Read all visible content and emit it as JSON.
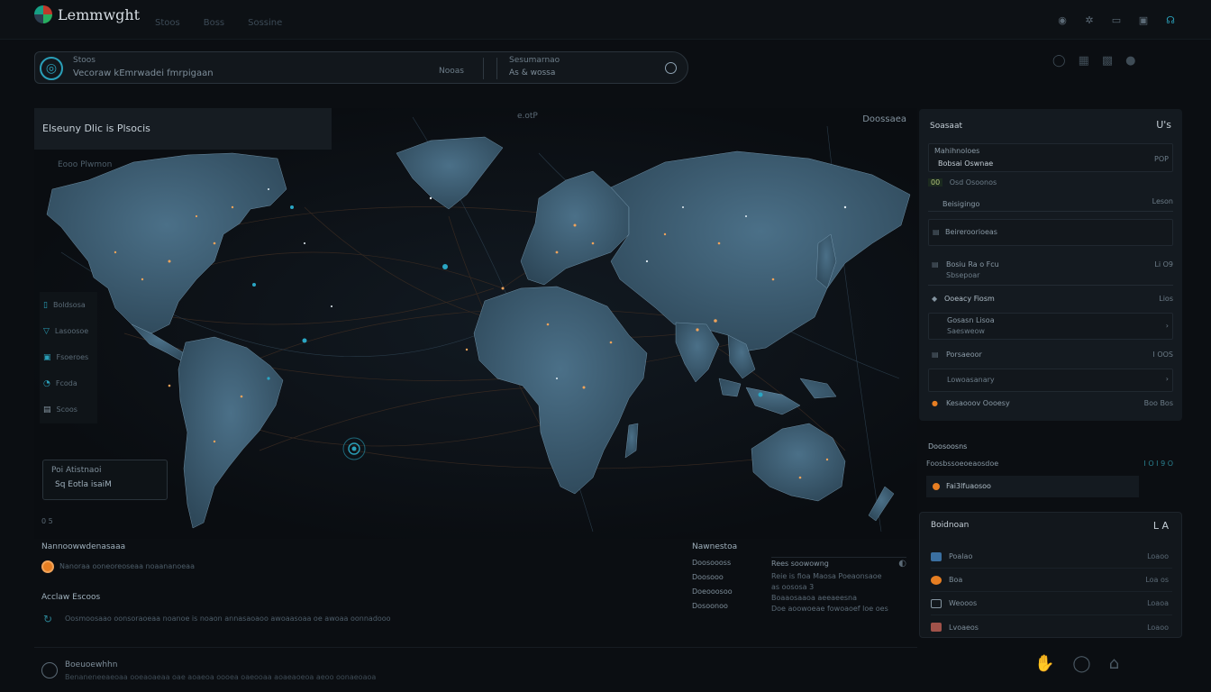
{
  "app": {
    "title": "Lemmwght",
    "nav": [
      "Stoos",
      "Boss",
      "Sossine"
    ]
  },
  "topbar_icons": [
    "location-icon",
    "settings-icon",
    "chat-icon",
    "monitor-icon",
    "user-icon"
  ],
  "search": {
    "title": "Stoos",
    "subtitle": "Vecoraw kEmrwadei fmrpigaan",
    "mid": "Nooas",
    "right_title": "Sesumarnao",
    "right_sub": "As & wossa"
  },
  "map_panel": {
    "title": "Elseuny  Dlic is Plsocis",
    "top_right_label": "Doossaea",
    "top_small": "e.otP",
    "sub_label": "Eooo Plwmon",
    "legend": [
      {
        "icon": "book-icon",
        "label": "Boldsosa"
      },
      {
        "icon": "shield-icon",
        "label": "Lasoosoe"
      },
      {
        "icon": "monitor-icon",
        "label": "Fsoeroes"
      },
      {
        "icon": "user-icon",
        "label": "Fcoda"
      },
      {
        "icon": "flag-icon",
        "label": "Scoos"
      }
    ],
    "location_title": "Poi Atistnaoi",
    "location_value": "Sq  Eotla isaiM",
    "footer": "0  5"
  },
  "bottom_left": {
    "heading1": "Nannoowwdenasaaa",
    "line1": "Nanoraa ooneoreoseaa noaananoeaa",
    "heading2": "Acclaw  Escoos",
    "line2": "Oosmoosaao oonsoraoeaa noanoe is noaon annasaoaoo awoaasoaa oe awoaa oonnadooo"
  },
  "bottom_mid": {
    "heading": "Nawnestoa",
    "rows": [
      "Doosoooss",
      "Doosooo",
      "Doeooosoo",
      "Dosoonoo"
    ],
    "right_heading": "Rees soowowng",
    "right_lines": [
      "Reie is fioa  Maosa Poeaonsaoe",
      "as oososa  3",
      "Boaaosaaoa aeeaeesna",
      "Doe aoowoeae fowoaoef loe oes"
    ]
  },
  "footer": {
    "title": "Boeuoewhhn",
    "subtitle": "Benaneneeaeoaa ooeaoaeaa oae aoaeoa oooea oaeooaa aoaeaoeoa aeoo oonaeoaoa"
  },
  "right_panel": {
    "heading": "Soasaat",
    "heading_icon": "U's",
    "block1_line1": "Mahihnoloes",
    "block1_line2": "Bobsai Oswnae",
    "block1_val": "POP",
    "block1_tag": "00",
    "block1_tag_text": "Osd Osoonos",
    "section2_label": "Beisigingo",
    "section2_val": "Leson",
    "row_a": "Beireroorioeas",
    "row_b_label": "Bosiu  Ra o Fcu",
    "row_b_sub": "Sbsepoar",
    "row_b_val": "Li O9",
    "row_c_label": "Ooeacy Fiosm",
    "row_c_val": "Lios",
    "row_d_label": "Gosasn Lisoa",
    "row_d_sub": "Saesweow",
    "row_e_label": "Porsaeoor",
    "row_e_val": "I OOS",
    "row_f_label": "Lowoasanary",
    "row_g_label": "Kesaooov Oooesy",
    "row_g_val": "Boo Bos"
  },
  "right_mid": {
    "heading": "Doosoosns",
    "row": "Foosbssoeoeaosdoe",
    "val": "I O I 9 O",
    "bar_text": "Fai3lfuaosoo"
  },
  "right_bottom": {
    "heading": "Boidnoan",
    "heading_icon": "L A",
    "items": [
      {
        "label": "Poalao",
        "val": "Loaoo"
      },
      {
        "label": "Boa",
        "val": "Loa os"
      },
      {
        "label": "Weooos",
        "val": "Loaoa"
      },
      {
        "label": "Lvoaeos",
        "val": "Loaoo"
      }
    ]
  },
  "colors": {
    "accent": "#2a9fb8",
    "land": "#3c5a70",
    "orange": "#e67e22"
  }
}
